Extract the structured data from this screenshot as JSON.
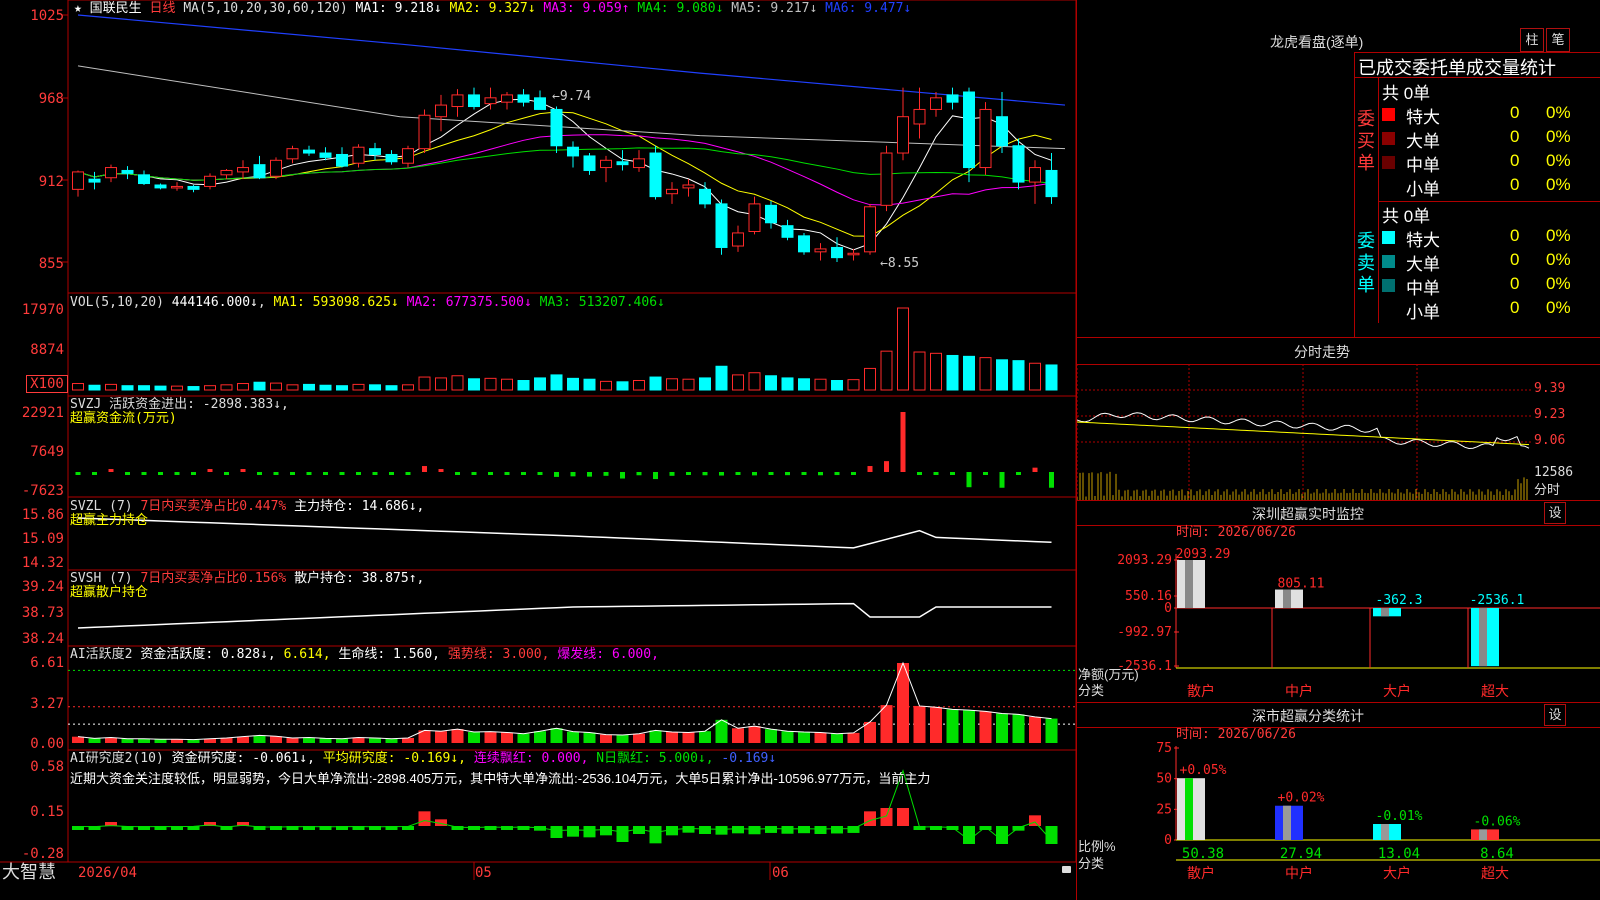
{
  "colors": {
    "up": "#ff2a2a",
    "down": "#00ffff",
    "grid": "#b00000",
    "white": "#ffffff",
    "yellow": "#ffff00",
    "magenta": "#ff00ff",
    "green": "#00e000",
    "blue": "#2040ff",
    "gray": "#c0c0c0"
  },
  "main": {
    "star": "★",
    "name": "国联民生",
    "period": "日线",
    "ma_title": "MA(5,10,20,30,60,120)",
    "ma_values": [
      {
        "label": "MA1:",
        "value": "9.218↓",
        "color": "#ffffff"
      },
      {
        "label": "MA2:",
        "value": "9.327↓",
        "color": "#ffff00"
      },
      {
        "label": "MA3:",
        "value": "9.059↑",
        "color": "#ff00ff"
      },
      {
        "label": "MA4:",
        "value": "9.080↓",
        "color": "#00e000"
      },
      {
        "label": "MA5:",
        "value": "9.217↓",
        "color": "#c0c0c0"
      },
      {
        "label": "MA6:",
        "value": "9.477↓",
        "color": "#2040ff"
      }
    ],
    "y_ticks": [
      "1025",
      "968",
      "912",
      "855"
    ],
    "high_mark": "9.74",
    "low_mark": "8.55"
  },
  "vol": {
    "title": "VOL(5,10,20)",
    "value": "444146.000↓",
    "mas": [
      {
        "t": "MA1: 593098.625↓",
        "color": "#ffffff"
      },
      {
        "t": "MA2: 677375.500↓",
        "color": "#ff00ff"
      },
      {
        "t": "MA3: 513207.406↓",
        "color": "#00e000"
      }
    ],
    "y_ticks": [
      "17970",
      "8874"
    ],
    "unit": "X100"
  },
  "svzj": {
    "title": "SVZJ  活跃资金进出: -2898.383↓,",
    "sub": "超赢资金流(万元)",
    "y_ticks": [
      "22921",
      "7649",
      "-7623"
    ]
  },
  "svzl": {
    "title": "SVZL (7)",
    "t1": "7日内买卖净占比0.447%",
    "t2": "主力持仓: 14.686↓,",
    "sub": "超赢主力持仓",
    "y_ticks": [
      "15.86",
      "15.09",
      "14.32"
    ]
  },
  "svsh": {
    "title": "SVSH (7)",
    "t1": "7日内买卖净占比0.156%",
    "t2": "散户持仓: 38.875↑,",
    "sub": "超赢散户持仓",
    "y_ticks": [
      "39.24",
      "38.73",
      "38.24"
    ]
  },
  "ai1": {
    "title": "AI活跃度2",
    "t1": "资金活跃度: 0.828↓,",
    "t2": "6.614,",
    "t3": "生命线: 1.560,",
    "t4": "强势线: 3.000,",
    "t5": "爆发线: 6.000,",
    "y_ticks": [
      "6.61",
      "3.27",
      "0.00"
    ]
  },
  "ai2": {
    "title": "AI研究度2(10)",
    "t1": "资金研究度: -0.061↓,",
    "t2": "平均研究度: -0.169↓,",
    "t3": "连续飘红: 0.000,",
    "t4": "N日飘红: 5.000↓,",
    "t5": "-0.169↓",
    "comment": "近期大资金关注度较低，明显弱势，今日大单净流出:-2898.405万元，其中特大单净流出:-2536.104万元，大单5日累计净出-10596.977万元，当前主力",
    "y_ticks": [
      "0.58",
      "0.15",
      "-0.28"
    ]
  },
  "bottom": {
    "brand": "大智慧",
    "date": "2026/04",
    "m5": "05",
    "m6": "06"
  },
  "right": {
    "lhkp_title": "龙虎看盘(逐单)",
    "btn_zhu": "柱",
    "btn_bi": "笔",
    "stat_title": "已成交委托单成交量统计",
    "buy": {
      "side": "委买单",
      "total": "共 0单",
      "rows": [
        {
          "name": "特大",
          "n": "0",
          "p": "0%",
          "color": "#ff0000"
        },
        {
          "name": "大单",
          "n": "0",
          "p": "0%",
          "color": "#8b0000"
        },
        {
          "name": "中单",
          "n": "0",
          "p": "0%",
          "color": "#6a0000"
        },
        {
          "name": "小单",
          "n": "0",
          "p": "0%",
          "color": "#000000"
        }
      ]
    },
    "sell": {
      "side": "委卖单",
      "total": "共 0单",
      "rows": [
        {
          "name": "特大",
          "n": "0",
          "p": "0%",
          "color": "#00ffff"
        },
        {
          "name": "大单",
          "n": "0",
          "p": "0%",
          "color": "#008b8b"
        },
        {
          "name": "中单",
          "n": "0",
          "p": "0%",
          "color": "#007070"
        },
        {
          "name": "小单",
          "n": "0",
          "p": "0%",
          "color": "#000000"
        }
      ]
    },
    "fenshi_title": "分时走势",
    "fenshi_prices": [
      "9.39",
      "9.23",
      "9.06"
    ],
    "fenshi_vol": "12586",
    "fenshi_label": "分时",
    "monitor": {
      "title": "深圳超赢实时监控",
      "btn": "设",
      "time": "时间: 2026/06/26",
      "y_ticks": [
        "2093.29",
        "550.16",
        "0",
        "-992.97",
        "-2536.1"
      ],
      "unit": "净额(万元)",
      "cat_label": "分类",
      "categories": [
        "散户",
        "中户",
        "大户",
        "超大"
      ],
      "values": [
        2093.29,
        805.11,
        -362.3,
        -2536.1
      ],
      "value_labels": [
        "2093.29",
        "805.11",
        "-362.3",
        "-2536.1"
      ]
    },
    "classify": {
      "title": "深市超赢分类统计",
      "btn": "设",
      "time": "时间: 2026/06/26",
      "y_ticks": [
        "75",
        "50",
        "25",
        "0"
      ],
      "unit": "比例%",
      "cat_label": "分类",
      "categories": [
        "散户",
        "中户",
        "大户",
        "超大"
      ],
      "values": [
        50.38,
        27.94,
        13.04,
        8.64
      ],
      "changes": [
        "+0.05%",
        "+0.02%",
        "-0.01%",
        "-0.06%"
      ]
    }
  },
  "chart_data": {
    "type": "candlestick",
    "title": "国联民生 日线",
    "ohlc": [
      [
        9.05,
        9.18,
        9.0,
        9.17
      ],
      [
        9.12,
        9.17,
        9.05,
        9.1
      ],
      [
        9.13,
        9.22,
        9.1,
        9.2
      ],
      [
        9.18,
        9.21,
        9.12,
        9.16
      ],
      [
        9.15,
        9.18,
        9.08,
        9.09
      ],
      [
        9.08,
        9.09,
        9.05,
        9.06
      ],
      [
        9.06,
        9.1,
        9.04,
        9.07
      ],
      [
        9.07,
        9.08,
        9.03,
        9.05
      ],
      [
        9.07,
        9.16,
        9.05,
        9.14
      ],
      [
        9.15,
        9.19,
        9.12,
        9.18
      ],
      [
        9.17,
        9.25,
        9.12,
        9.2
      ],
      [
        9.22,
        9.28,
        9.12,
        9.13
      ],
      [
        9.14,
        9.27,
        9.12,
        9.25
      ],
      [
        9.26,
        9.35,
        9.23,
        9.33
      ],
      [
        9.32,
        9.35,
        9.28,
        9.3
      ],
      [
        9.3,
        9.34,
        9.25,
        9.27
      ],
      [
        9.29,
        9.34,
        9.2,
        9.21
      ],
      [
        9.23,
        9.36,
        9.2,
        9.34
      ],
      [
        9.33,
        9.37,
        9.25,
        9.29
      ],
      [
        9.29,
        9.32,
        9.22,
        9.24
      ],
      [
        9.23,
        9.35,
        9.2,
        9.33
      ],
      [
        9.33,
        9.6,
        9.3,
        9.56
      ],
      [
        9.55,
        9.7,
        9.45,
        9.63
      ],
      [
        9.62,
        9.74,
        9.55,
        9.7
      ],
      [
        9.7,
        9.75,
        9.6,
        9.62
      ],
      [
        9.64,
        9.75,
        9.6,
        9.68
      ],
      [
        9.65,
        9.72,
        9.6,
        9.7
      ],
      [
        9.7,
        9.74,
        9.62,
        9.65
      ],
      [
        9.68,
        9.73,
        9.62,
        9.6
      ],
      [
        9.6,
        9.62,
        9.3,
        9.35
      ],
      [
        9.34,
        9.38,
        9.2,
        9.28
      ],
      [
        9.28,
        9.3,
        9.15,
        9.18
      ],
      [
        9.2,
        9.28,
        9.1,
        9.25
      ],
      [
        9.24,
        9.32,
        9.18,
        9.22
      ],
      [
        9.2,
        9.32,
        9.17,
        9.26
      ],
      [
        9.3,
        9.35,
        8.98,
        9.0
      ],
      [
        9.02,
        9.1,
        8.95,
        9.05
      ],
      [
        9.06,
        9.12,
        9.0,
        9.08
      ],
      [
        9.05,
        9.1,
        8.92,
        8.95
      ],
      [
        8.95,
        8.98,
        8.6,
        8.65
      ],
      [
        8.66,
        8.8,
        8.62,
        8.75
      ],
      [
        8.76,
        9.0,
        8.74,
        8.95
      ],
      [
        8.94,
        8.97,
        8.78,
        8.82
      ],
      [
        8.8,
        8.84,
        8.7,
        8.72
      ],
      [
        8.73,
        8.75,
        8.6,
        8.62
      ],
      [
        8.62,
        8.68,
        8.56,
        8.64
      ],
      [
        8.65,
        8.72,
        8.55,
        8.58
      ],
      [
        8.6,
        8.64,
        8.56,
        8.61
      ],
      [
        8.62,
        8.95,
        8.6,
        8.93
      ],
      [
        8.94,
        9.35,
        8.9,
        9.3
      ],
      [
        9.3,
        9.75,
        9.25,
        9.55
      ],
      [
        9.5,
        9.75,
        9.4,
        9.6
      ],
      [
        9.6,
        9.72,
        9.55,
        9.68
      ],
      [
        9.7,
        9.75,
        9.6,
        9.65
      ],
      [
        9.72,
        9.75,
        9.1,
        9.2
      ],
      [
        9.2,
        9.65,
        9.15,
        9.6
      ],
      [
        9.55,
        9.72,
        9.3,
        9.35
      ],
      [
        9.35,
        9.4,
        9.05,
        9.1
      ],
      [
        9.1,
        9.25,
        8.95,
        9.2
      ],
      [
        9.18,
        9.3,
        8.95,
        9.0
      ]
    ],
    "volume": [
      15,
      11,
      13,
      10,
      10,
      9,
      9,
      8,
      10,
      12,
      15,
      18,
      16,
      12,
      13,
      11,
      10,
      13,
      12,
      10,
      12,
      30,
      28,
      33,
      26,
      27,
      25,
      22,
      28,
      35,
      27,
      25,
      20,
      19,
      22,
      30,
      26,
      25,
      28,
      55,
      35,
      40,
      33,
      28,
      26,
      25,
      22,
      24,
      50,
      90,
      190,
      88,
      85,
      80,
      78,
      75,
      70,
      68,
      62,
      58
    ],
    "money_flow": [
      -100,
      -120,
      80,
      -110,
      -150,
      -90,
      -130,
      -80,
      200,
      -200,
      150,
      -180,
      -190,
      -160,
      -120,
      -150,
      -140,
      -110,
      -170,
      -130,
      -100,
      1100,
      500,
      -250,
      -300,
      -210,
      -280,
      -200,
      -350,
      -900,
      -800,
      -850,
      -700,
      -1200,
      -600,
      -1300,
      -700,
      -500,
      -600,
      -650,
      -550,
      -620,
      -520,
      -580,
      -540,
      -600,
      -560,
      -520,
      1100,
      2000,
      11050,
      -200,
      -150,
      -300,
      -2800,
      -200,
      -2900,
      -350,
      800,
      -2898
    ]
  }
}
